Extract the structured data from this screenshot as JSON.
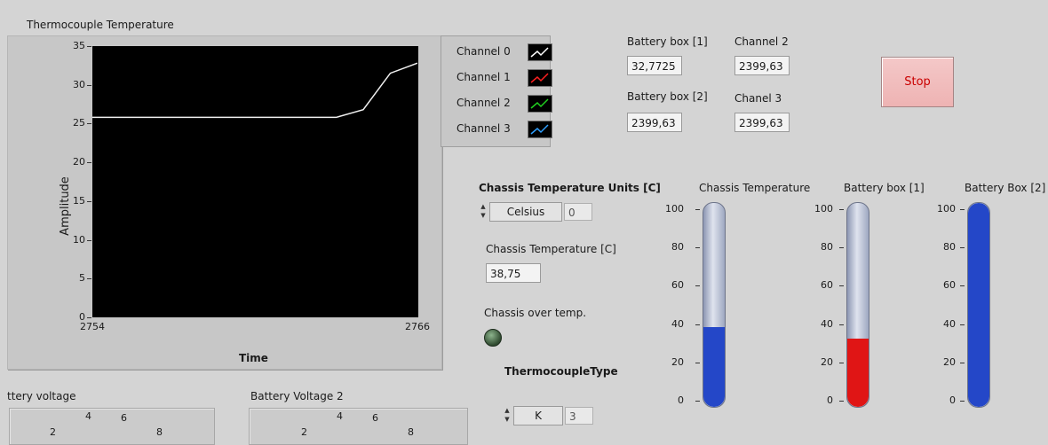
{
  "graph": {
    "title": "Thermocouple Temperature",
    "xlabel": "Time",
    "ylabel": "Amplitude",
    "yticks": [
      "35",
      "30",
      "25",
      "20",
      "15",
      "10",
      "5",
      "0"
    ],
    "xticks": [
      "2754",
      "2766"
    ]
  },
  "legend": [
    {
      "name": "Channel 0",
      "icon": "white-line-icon",
      "color": "#ffffff"
    },
    {
      "name": "Channel 1",
      "icon": "red-line-icon",
      "color": "#ff2020"
    },
    {
      "name": "Channel 2",
      "icon": "green-line-icon",
      "color": "#20d020"
    },
    {
      "name": "Channel 3",
      "icon": "blue-line-icon",
      "color": "#30a0ff"
    }
  ],
  "chart_data": {
    "type": "line",
    "xlim": [
      2754,
      2766
    ],
    "ylim": [
      0,
      35
    ],
    "series": [
      {
        "name": "Channel 0",
        "color": "#f0f0f0",
        "x": [
          2754,
          2763,
          2764,
          2765,
          2766
        ],
        "y": [
          25.8,
          25.8,
          26.8,
          31.5,
          32.8
        ]
      }
    ]
  },
  "indicators": {
    "battery_box_1_label": "Battery box [1]",
    "battery_box_1_value": "32,7725",
    "channel_2_label": "Channel 2",
    "channel_2_value": "2399,63",
    "battery_box_2_label": "Battery box [2]",
    "battery_box_2_value": "2399,63",
    "chanel_3_label": "Chanel 3",
    "chanel_3_value": "2399,63"
  },
  "stop_label": "Stop",
  "units": {
    "label": "Chassis Temperature Units [C]",
    "selected": "Celsius",
    "index": "0"
  },
  "chassis_temp": {
    "label": "Chassis Temperature  [C]",
    "value": "38,75"
  },
  "overtemp": {
    "label": "Chassis over temp."
  },
  "thermocouple_type": {
    "label": "ThermocoupleType",
    "selected": "K",
    "index": "3"
  },
  "thermometers": [
    {
      "label": "Chassis Temperature",
      "level": 38.75,
      "fill": "#2447c8"
    },
    {
      "label": "Battery box [1]",
      "level": 32.8,
      "fill": "#e01515"
    },
    {
      "label": "Battery Box [2]",
      "level": 100,
      "fill": "#2447c8"
    }
  ],
  "thermo_scale": [
    "100",
    "80",
    "60",
    "40",
    "20",
    "0"
  ],
  "bottom": {
    "battery_voltage_label": "ttery voltage",
    "battery_voltage_2_label": "Battery Voltage 2",
    "dial_numbers": [
      "4",
      "6",
      "2",
      "8"
    ]
  }
}
